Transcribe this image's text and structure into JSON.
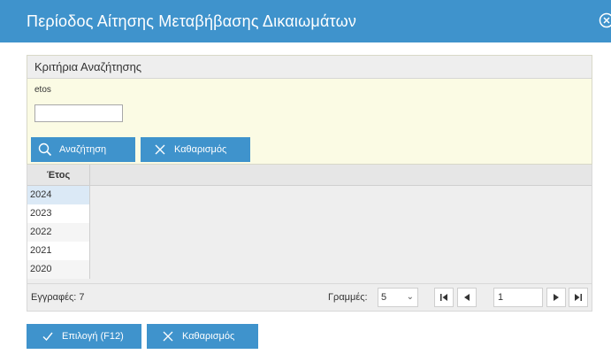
{
  "dialog": {
    "title": "Περίοδος Αίτησης Μεταβήβασης Δικαιωμάτων",
    "close_icon": "close-circle-icon"
  },
  "criteria": {
    "header": "Κριτήρια Αναζήτησης",
    "field_label": "etos",
    "field_value": "",
    "search_button": "Αναζήτηση",
    "search_icon": "search-icon",
    "clear_button": "Καθαρισμός",
    "clear_icon": "x-icon"
  },
  "grid": {
    "column": "Έτος",
    "rows": [
      "2024",
      "2023",
      "2022",
      "2021",
      "2020"
    ],
    "selected_index": 0
  },
  "footer": {
    "records": "Εγγραφές: 7",
    "rows_label": "Γραμμές:",
    "rows_value": "5",
    "page_value": "1"
  },
  "actions": {
    "ok_button": "Επιλογή (F12)",
    "ok_icon": "check-icon",
    "clear_button": "Καθαρισμός",
    "clear_icon": "x-icon"
  },
  "colors": {
    "accent": "#3f93cc",
    "criteria_bg": "#fbfbe4",
    "selected_row": "#dbe9f6"
  }
}
